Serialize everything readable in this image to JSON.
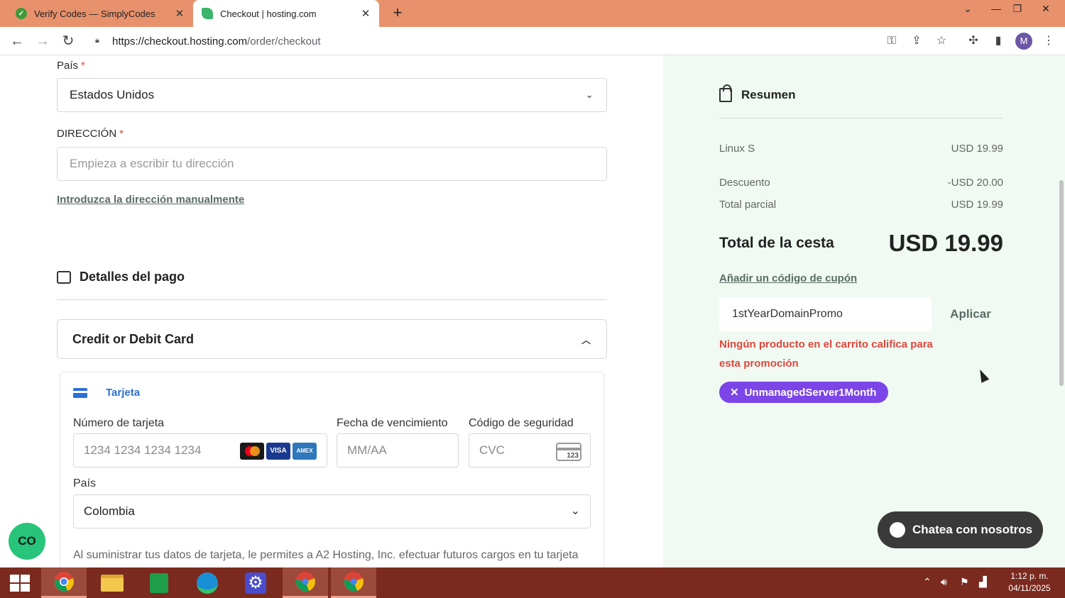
{
  "browser": {
    "tabs": [
      {
        "title": "Verify Codes — SimplyCodes",
        "active": false
      },
      {
        "title": "Checkout | hosting.com",
        "active": true
      }
    ],
    "new_tab": "+",
    "url_host": "https://checkout.hosting.com",
    "url_path": "/order/checkout",
    "profile_initial": "M"
  },
  "form": {
    "country_label": "País",
    "country_value": "Estados Unidos",
    "address_label": "DIRECCIÓN",
    "address_placeholder": "Empieza a escribir tu dirección",
    "manual_address_link": "Introduzca la dirección manualmente",
    "required_mark": "*"
  },
  "payment": {
    "section_title": "Detalles del pago",
    "method_title": "Credit or Debit Card",
    "card_tab_label": "Tarjeta",
    "card_number_label": "Número de tarjeta",
    "card_number_placeholder": "1234 1234 1234 1234",
    "expiry_label": "Fecha de vencimiento",
    "expiry_placeholder": "MM/AA",
    "cvc_label": "Código de seguridad",
    "cvc_placeholder": "CVC",
    "cvc_icon_text": "123",
    "brands": [
      "mastercard",
      "VISA",
      "AMEX"
    ],
    "billing_country_label": "País",
    "billing_country_value": "Colombia",
    "legal_text": "Al suministrar tus datos de tarjeta, le permites a A2 Hosting, Inc. efectuar futuros cargos en tu tarjeta conforme a las condiciones estipuladas."
  },
  "summary": {
    "title": "Resumen",
    "rows": [
      {
        "label": "Linux S",
        "value": "USD 19.99"
      },
      {
        "label": "Descuento",
        "value": "-USD 20.00"
      },
      {
        "label": "Total parcial",
        "value": "USD 19.99"
      }
    ],
    "total_label": "Total de la cesta",
    "total_value": "USD 19.99",
    "coupon_link": "Añadir un código de cupón",
    "coupon_value": "1stYearDomainPromo",
    "apply_label": "Aplicar",
    "coupon_error": "Ningún producto en el carrito califica para esta promoción",
    "applied_promo": "UnmanagedServer1Month"
  },
  "chat": {
    "label": "Chatea con nosotros",
    "badge": "CO"
  },
  "taskbar": {
    "time": "1:12 p. m.",
    "date": "04/11/2025"
  },
  "colors": {
    "accent_purple": "#7b45e8",
    "error_red": "#e0463c",
    "sidebar_bg": "#f0faf3",
    "tab_bar": "#e8916d"
  }
}
